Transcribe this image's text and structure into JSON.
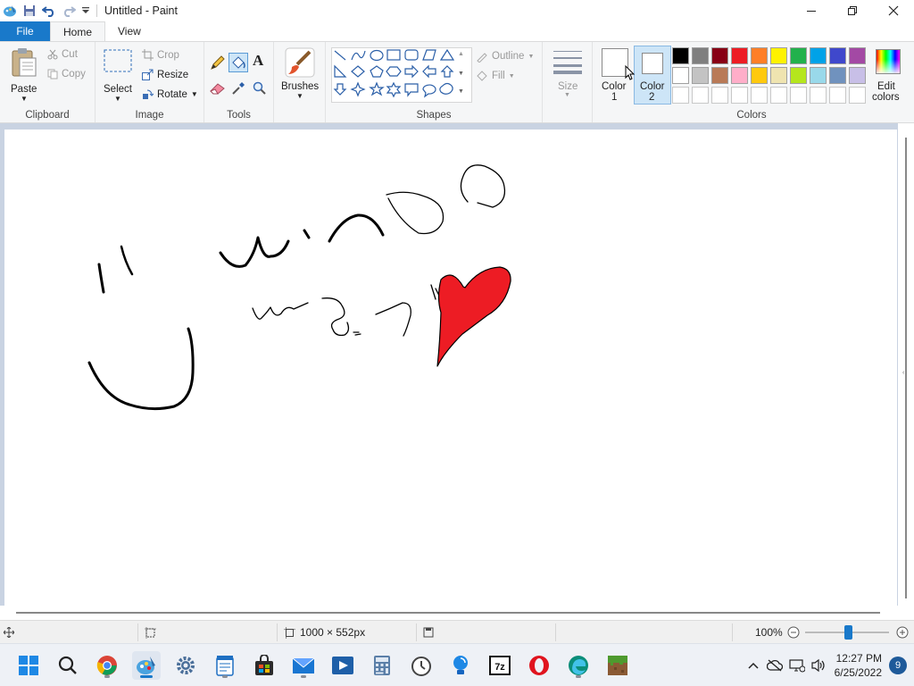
{
  "window": {
    "title": "Untitled - Paint",
    "minimize": "minimize",
    "maximize": "maximize",
    "close": "close"
  },
  "tabs": [
    {
      "label": "File"
    },
    {
      "label": "Home"
    },
    {
      "label": "View"
    }
  ],
  "clipboard": {
    "paste": "Paste",
    "cut": "Cut",
    "copy": "Copy",
    "label": "Clipboard"
  },
  "image": {
    "select": "Select",
    "crop": "Crop",
    "resize": "Resize",
    "rotate": "Rotate",
    "label": "Image"
  },
  "tools": {
    "label": "Tools",
    "text_tool": "A"
  },
  "brushes": {
    "label": "Brushes"
  },
  "shapes": {
    "outline": "Outline",
    "fill": "Fill",
    "label": "Shapes"
  },
  "size": {
    "label": "Size"
  },
  "colors": {
    "color1_line1": "Color",
    "color1_line2": "1",
    "color2_line1": "Color",
    "color2_line2": "2",
    "edit_line1": "Edit",
    "edit_line2": "colors",
    "label": "Colors",
    "palette_row1": [
      "#000000",
      "#7f7f7f",
      "#880015",
      "#ed1c24",
      "#ff7f27",
      "#fff200",
      "#22b14c",
      "#00a2e8",
      "#3f48cc",
      "#a349a4"
    ],
    "palette_row2": [
      "#ffffff",
      "#c3c3c3",
      "#b97a57",
      "#ffaec9",
      "#ffc90e",
      "#efe4b0",
      "#b5e61d",
      "#99d9ea",
      "#7092be",
      "#c8bfe7"
    ],
    "heart_red": "#ed1c24"
  },
  "status": {
    "dimensions": "1000 × 552px",
    "zoom": "100%"
  },
  "clock": {
    "time": "12:27 PM",
    "date": "6/25/2022",
    "notifications": "9"
  }
}
